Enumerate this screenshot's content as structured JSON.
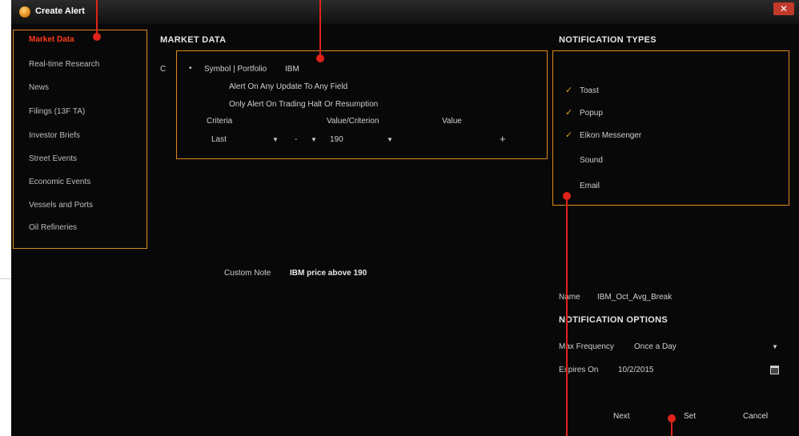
{
  "window": {
    "title": "Create Alert",
    "close_label": "✕"
  },
  "sidebar": {
    "items": [
      {
        "label": "Market Data",
        "active": true
      },
      {
        "label": "Real-time Research"
      },
      {
        "label": "News"
      },
      {
        "label": "Filings (13F TA)"
      },
      {
        "label": "Investor Briefs"
      },
      {
        "label": "Street Events"
      },
      {
        "label": "Economic Events"
      },
      {
        "label": "Vessels and Ports"
      },
      {
        "label": "Oil Refineries"
      }
    ]
  },
  "market_data": {
    "title": "MARKET DATA",
    "radio_label": "Symbol | Portfolio",
    "symbol_value": "IBM",
    "option_any_update": "Alert On Any Update To Any Field",
    "option_halt": "Only Alert On Trading Halt Or Resumption",
    "criteria_header": "Criteria",
    "value_criterion_header": "Value/Criterion",
    "value_header": "Value",
    "criteria_value": "Last",
    "operator_value": "-",
    "criterion_value": "190",
    "add_label": "+"
  },
  "custom_note": {
    "label": "Custom Note",
    "value": "IBM price above 190"
  },
  "notification_types": {
    "title": "NOTIFICATION TYPES",
    "items": [
      {
        "label": "Toast",
        "checked": true
      },
      {
        "label": "Popup",
        "checked": true
      },
      {
        "label": "Eikon Messenger",
        "checked": true
      },
      {
        "label": "Sound",
        "checked": false
      },
      {
        "label": "Email",
        "checked": false
      }
    ]
  },
  "name_field": {
    "label": "Name",
    "value": "IBM_Oct_Avg_Break"
  },
  "notification_options": {
    "title": "NOTIFICATION OPTIONS",
    "max_frequency_label": "Max Frequency",
    "max_frequency_value": "Once a Day",
    "expires_label": "Expires On",
    "expires_value": "10/2/2015"
  },
  "buttons": {
    "next": "Next",
    "set": "Set",
    "cancel": "Cancel"
  },
  "colors": {
    "accent": "#e08a1e",
    "marker": "#e0231a",
    "active_item": "#ff3a1a",
    "background": "#080808"
  }
}
